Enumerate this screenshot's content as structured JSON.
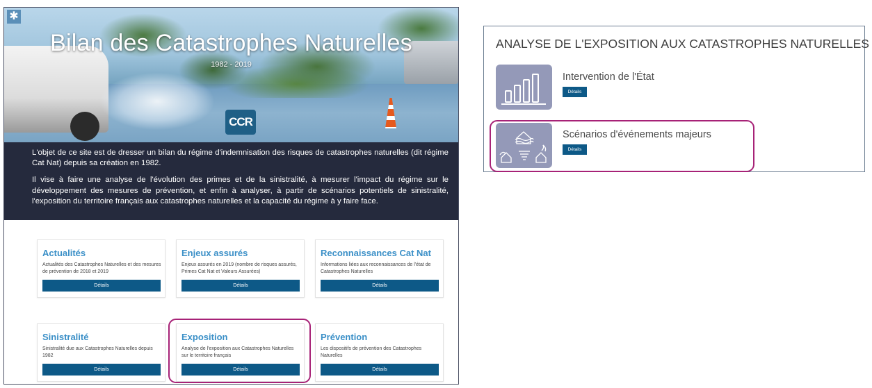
{
  "hero": {
    "title": "Bilan des Catastrophes Naturelles",
    "years": "1982 - 2019",
    "logo_text": "CCR"
  },
  "intro": {
    "paragraph1": "L'objet de ce site est de dresser un bilan du régime d'indemnisation des risques de catastrophes naturelles (dit régime Cat Nat) depuis sa création en 1982.",
    "paragraph2": "Il vise à faire une analyse de l'évolution des primes et de la sinistralité, à mesurer l'impact du régime sur le développement des mesures de prévention, et enfin à analyser, à partir de scénarios potentiels de sinistralité, l'exposition du territoire français aux catastrophes naturelles et la capacité du régime à y faire face."
  },
  "cards": [
    {
      "title": "Actualités",
      "description": "Actualités des Catastrophes Naturelles et des mesures de prévention de 2018 et 2019",
      "button": "Détails"
    },
    {
      "title": "Enjeux assurés",
      "description": "Enjeux assurés en 2019 (nombre de risques assurés, Primes Cat Nat et Valeurs Assurées)",
      "button": "Détails"
    },
    {
      "title": "Reconnaissances Cat Nat",
      "description": "Informations liées aux reconnaissances de l'état de Catastrophes Naturelles",
      "button": "Détails"
    },
    {
      "title": "Sinistralité",
      "description": "Sinistralité due aux Catastrophes Naturelles depuis 1982",
      "button": "Détails"
    },
    {
      "title": "Exposition",
      "description": "Analyse de l'exposition aux Catastrophes Naturelles sur le territoire français",
      "button": "Détails"
    },
    {
      "title": "Prévention",
      "description": "Les dispositifs de prévention des Catastrophes Naturelles",
      "button": "Détails"
    }
  ],
  "exposition_panel": {
    "title": "ANALYSE DE L'EXPOSITION AUX CATASTROPHES NATURELLES",
    "items": [
      {
        "title": "Intervention de l'État",
        "button": "Détails",
        "icon": "bar-chart-icon"
      },
      {
        "title": "Scénarios d'événements majeurs",
        "button": "Détails",
        "icon": "disaster-scenarios-icon"
      }
    ]
  },
  "colors": {
    "accent_blue": "#0d5987",
    "title_blue": "#3a8fc7",
    "intro_bg": "#252a3d",
    "highlight": "#a72277",
    "icon_tile": "#9499b8"
  }
}
